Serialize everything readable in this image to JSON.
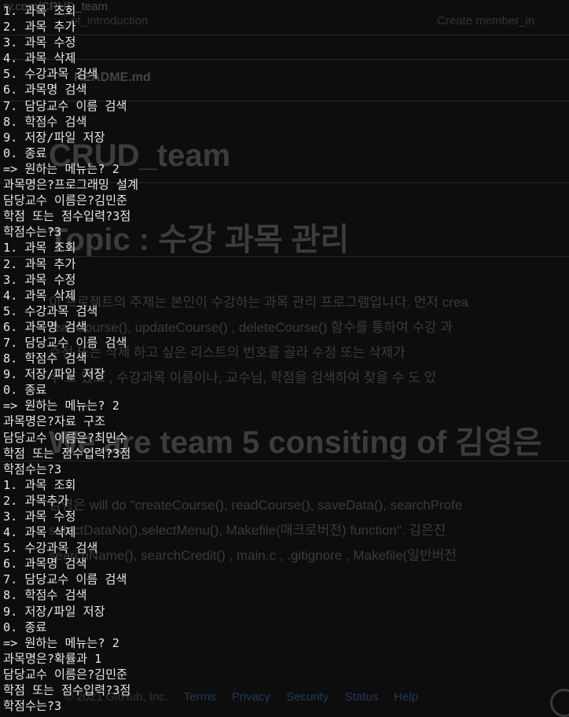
{
  "background_page": {
    "url": "ry.com/CRUD_team",
    "commit_left": "ot_introduction",
    "commit_right": "Create member_in",
    "readme_label": "README.md",
    "title": "CRUD_team",
    "topic_heading": "Topic : 수강 과목 관리",
    "paragraph1": [
      "이 프로젝트의 주제는 본인이 수강하는 과목 관리 프로그램입니다. 먼저 crea",
      "readCourse(), updateCourse() , deleteCourse() 함수를 통하여 수강 과",
      "수정 또는 삭제 하고 싶은 리스트의 번호를 골라 수정 또는 삭제가",
      "수 도 있고 , 수강과목 이름이나, 교수님, 학점을 검색하여 찾을 수 도 있"
    ],
    "team_heading": "We are team 5 consiting of 김영은",
    "paragraph2": [
      "김영은 will do \"createCourse(), readCourse(), saveData(), searchProfe",
      "selectDataNo(),selectMenu(), Makefile(매크로버전) function\". 김은진",
      "searchName(), searchCredit() , main.c , .gitignore , Makefile(일반버전"
    ],
    "footer": {
      "copyright": "© 2021 GitHub, Inc.",
      "links": [
        "Terms",
        "Privacy",
        "Security",
        "Status",
        "Help"
      ]
    }
  },
  "terminal": {
    "lines": [
      "1. 과목 조회",
      "2. 과목 추가",
      "3. 과목 수정",
      "4. 과목 삭제",
      "5. 수강과목 검색",
      "6. 과목명 검색",
      "7. 담당교수 이름 검색",
      "8. 학점수 검색",
      "9. 저장/파일 저장",
      "0. 종료",
      "=> 원하는 메뉴는? 2",
      "과목명은?프로그래밍 설계",
      "담당교수 이름은?김민준",
      "학점 또는 점수입력?3점",
      "학점수는?3",
      "1. 과목 조회",
      "2. 과목 추가",
      "3. 과목 수정",
      "4. 과목 삭제",
      "5. 수강과목 검색",
      "6. 과목명 검색",
      "7. 담당교수 이름 검색",
      "8. 학점수 검색",
      "9. 저장/파일 저장",
      "0. 종료",
      "=> 원하는 메뉴는? 2",
      "과목명은?자료 구조",
      "담당교수 이름은?최민수",
      "학점 또는 점수입력?3점",
      "학점수는?3",
      "1. 과목 조회",
      "2. 과목추가",
      "3. 과목 수정",
      "4. 과목 삭제",
      "5. 수강과목 검색",
      "6. 과목명 검색",
      "7. 담당교수 이름 검색",
      "8. 학점수 검색",
      "9. 저장/파일 저장",
      "0. 종료",
      "=> 원하는 메뉴는? 2",
      "과목명은?확률과 1",
      "담당교수 이름은?김민준",
      "학점 또는 점수입력?3점",
      "학점수는?3"
    ]
  }
}
